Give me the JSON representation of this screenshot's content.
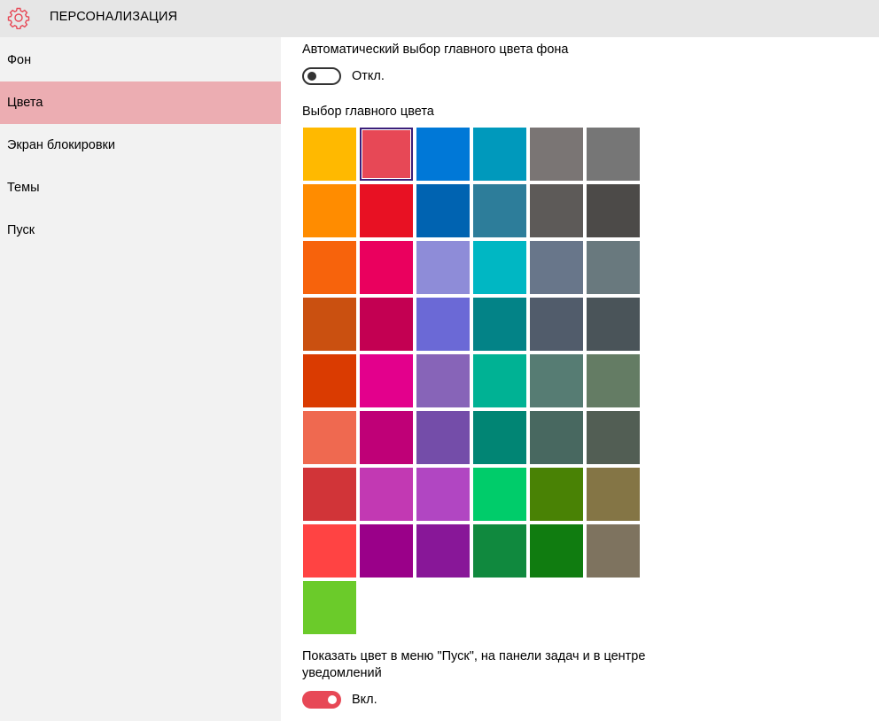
{
  "header": {
    "title": "ПЕРСОНАЛИЗАЦИЯ",
    "icon": "gear-icon",
    "accent_color": "#e74856"
  },
  "sidebar": {
    "items": [
      {
        "label": "Фон"
      },
      {
        "label": "Цвета",
        "active": true
      },
      {
        "label": "Экран блокировки"
      },
      {
        "label": "Темы"
      },
      {
        "label": "Пуск"
      }
    ]
  },
  "main": {
    "auto_color": {
      "label": "Автоматический выбор главного цвета фона",
      "state_label": "Откл.",
      "on": false
    },
    "accent_picker": {
      "label": "Выбор главного цвета",
      "selected_index": 1,
      "colors": [
        "#ffb900",
        "#e74856",
        "#0078d7",
        "#0099bc",
        "#7a7574",
        "#767676",
        "#ff8c00",
        "#e81123",
        "#0063b1",
        "#2d7d9a",
        "#5d5a58",
        "#4c4a48",
        "#f7630c",
        "#ea005e",
        "#8e8cd8",
        "#00b7c3",
        "#68768a",
        "#69797e",
        "#ca5010",
        "#c30052",
        "#6b69d6",
        "#038387",
        "#515c6b",
        "#4a5459",
        "#da3b01",
        "#e3008c",
        "#8764b8",
        "#00b294",
        "#567c73",
        "#647c64",
        "#ef6950",
        "#bf0077",
        "#744da9",
        "#018574",
        "#486860",
        "#525e54",
        "#d13438",
        "#c239b3",
        "#b146c2",
        "#00cc6a",
        "#498205",
        "#847545",
        "#ff4343",
        "#9a0089",
        "#881798",
        "#10893e",
        "#107c10",
        "#7e735f",
        "#6bcb2a"
      ]
    },
    "show_color": {
      "label_line1": "Показать цвет в меню \"Пуск\", на панели задач и в центре",
      "label_line2": "уведомлений",
      "state_label": "Вкл.",
      "on": true
    }
  }
}
